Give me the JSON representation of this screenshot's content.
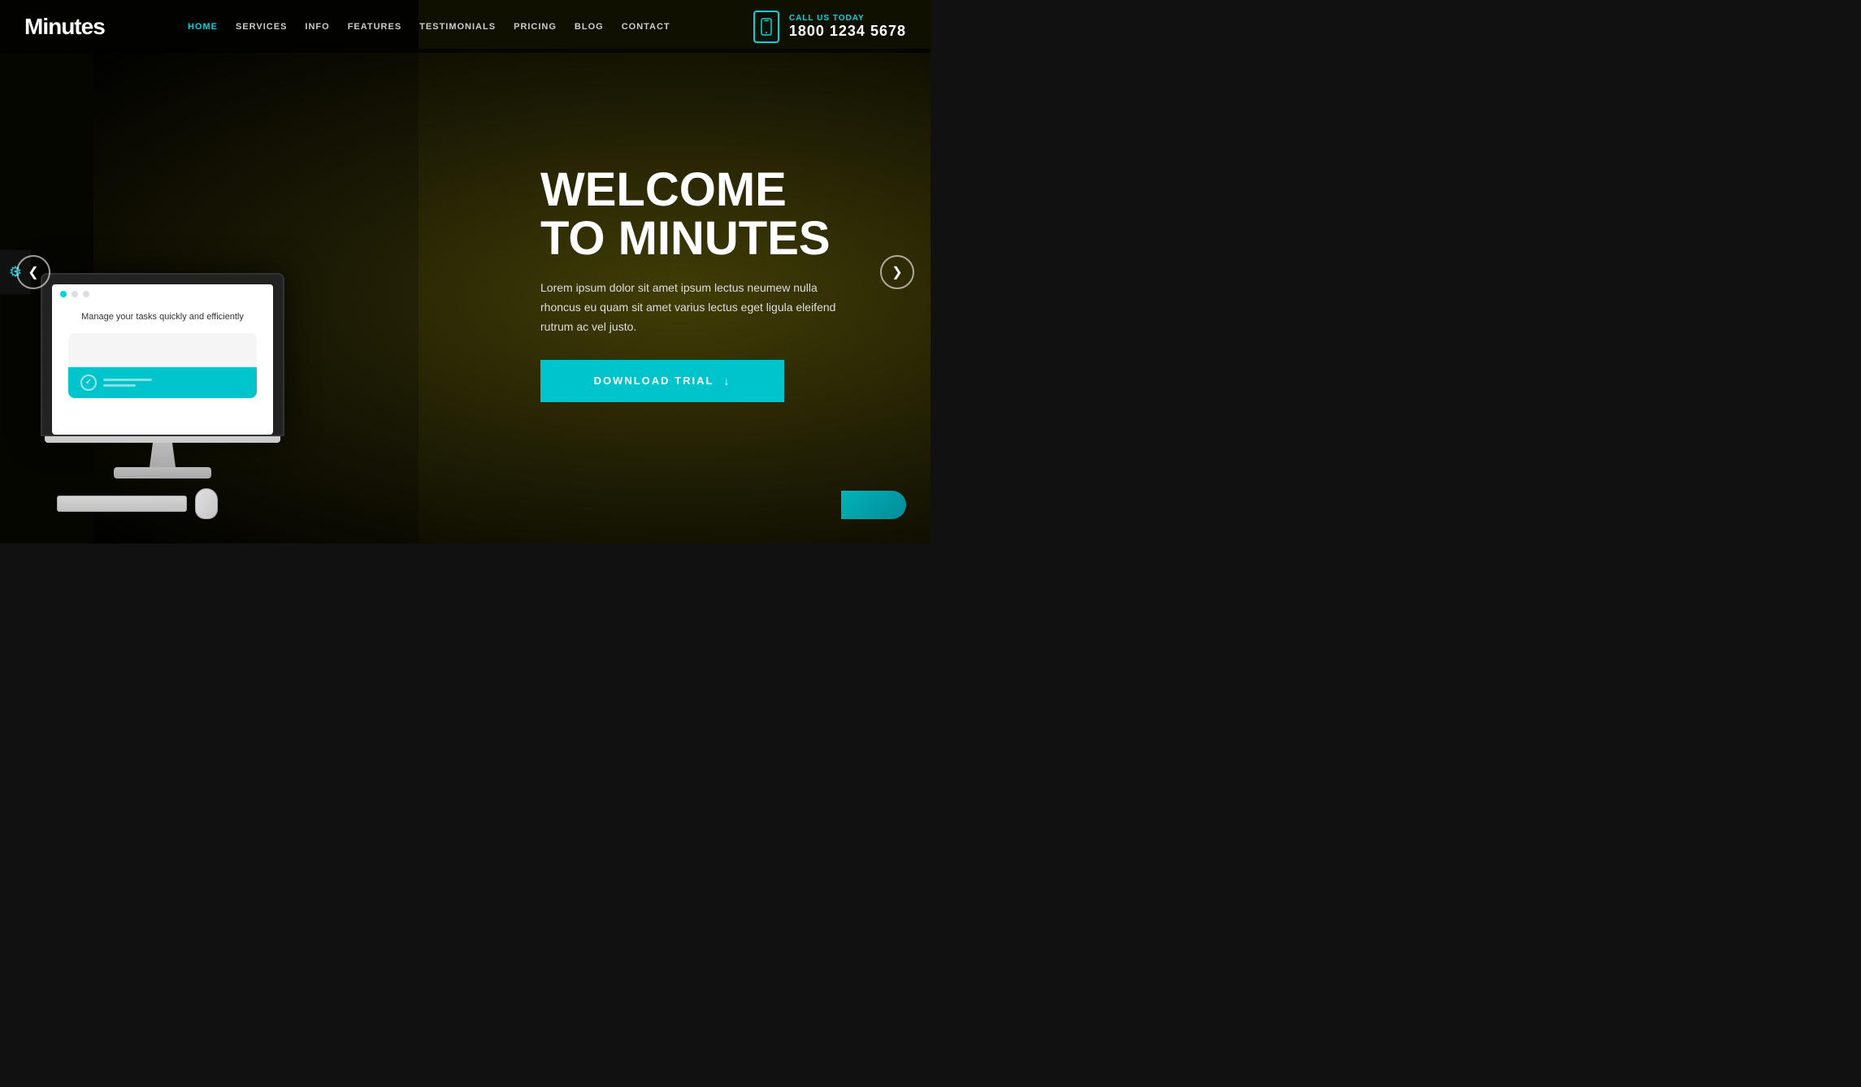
{
  "brand": {
    "logo": "Minutes"
  },
  "nav": {
    "items": [
      {
        "label": "HOME",
        "active": true
      },
      {
        "label": "SERVICES",
        "active": false
      },
      {
        "label": "INFO",
        "active": false
      },
      {
        "label": "FEATURES",
        "active": false
      },
      {
        "label": "TESTIMONIALS",
        "active": false
      },
      {
        "label": "PRICING",
        "active": false
      },
      {
        "label": "BLOG",
        "active": false
      },
      {
        "label": "CONTACT",
        "active": false
      }
    ]
  },
  "phone": {
    "call_label": "CALL US TODAY",
    "number": "1800 1234 5678"
  },
  "hero": {
    "title_line1": "WELCOME",
    "title_line2": "TO MINUTES",
    "description": "Lorem ipsum dolor sit amet ipsum lectus neumew nulla rhoncus eu quam sit amet varius lectus eget ligula eleifend\nrutrum ac vel justo.",
    "cta_label": "DOWNLOAD TRIAL",
    "monitor_text": "Manage your tasks quickly\nand efficiently"
  },
  "slider": {
    "prev_arrow": "❮",
    "next_arrow": "❯",
    "dots": [
      "active",
      "inactive",
      "inactive"
    ]
  },
  "icons": {
    "gear": "⚙",
    "phone": "📱",
    "download": "↓",
    "check": "✓"
  }
}
